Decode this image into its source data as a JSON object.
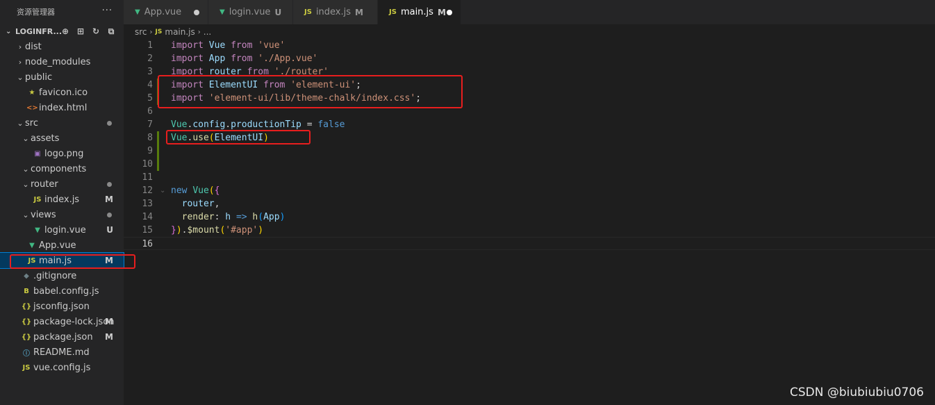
{
  "sidebar": {
    "title": "资源管理器",
    "more": "···",
    "project": "LOGINFR...",
    "items": [
      {
        "label": "dist",
        "icon": "",
        "depth": 0,
        "folder": true,
        "chev": "›",
        "badge": "",
        "dot": false,
        "iconName": "chevron-right-icon"
      },
      {
        "label": "node_modules",
        "icon": "",
        "depth": 0,
        "folder": true,
        "chev": "›",
        "badge": "",
        "dot": false,
        "iconName": "chevron-right-icon"
      },
      {
        "label": "public",
        "icon": "",
        "depth": 0,
        "folder": true,
        "chev": "⌄",
        "badge": "",
        "dot": false,
        "iconName": "chevron-down-icon"
      },
      {
        "label": "favicon.ico",
        "icon": "★",
        "cls": "c-star",
        "depth": 1,
        "folder": false,
        "badge": "",
        "dot": false,
        "iconName": "star-icon"
      },
      {
        "label": "index.html",
        "icon": "<>",
        "cls": "c-html",
        "depth": 1,
        "folder": false,
        "badge": "",
        "dot": false,
        "iconName": "html-icon"
      },
      {
        "label": "src",
        "icon": "",
        "depth": 0,
        "folder": true,
        "chev": "⌄",
        "badge": "",
        "dot": true,
        "iconName": "chevron-down-icon"
      },
      {
        "label": "assets",
        "icon": "",
        "depth": 1,
        "folder": true,
        "chev": "⌄",
        "badge": "",
        "dot": false,
        "iconName": "chevron-down-icon"
      },
      {
        "label": "logo.png",
        "icon": "▣",
        "cls": "c-img",
        "depth": 2,
        "folder": false,
        "badge": "",
        "dot": false,
        "iconName": "image-icon"
      },
      {
        "label": "components",
        "icon": "",
        "depth": 1,
        "folder": true,
        "chev": "⌄",
        "badge": "",
        "dot": false,
        "iconName": "chevron-down-icon"
      },
      {
        "label": "router",
        "icon": "",
        "depth": 1,
        "folder": true,
        "chev": "⌄",
        "badge": "",
        "dot": true,
        "iconName": "chevron-down-icon"
      },
      {
        "label": "index.js",
        "icon": "JS",
        "cls": "c-js",
        "depth": 2,
        "folder": false,
        "badge": "M",
        "dot": false,
        "iconName": "js-file-icon"
      },
      {
        "label": "views",
        "icon": "",
        "depth": 1,
        "folder": true,
        "chev": "⌄",
        "badge": "",
        "dot": true,
        "iconName": "chevron-down-icon"
      },
      {
        "label": "login.vue",
        "icon": "▼",
        "cls": "c-vue",
        "depth": 2,
        "folder": false,
        "badge": "U",
        "dot": false,
        "iconName": "vue-file-icon"
      },
      {
        "label": "App.vue",
        "icon": "▼",
        "cls": "c-vue",
        "depth": 1,
        "folder": false,
        "badge": "",
        "dot": false,
        "iconName": "vue-file-icon"
      },
      {
        "label": "main.js",
        "icon": "JS",
        "cls": "c-js",
        "depth": 1,
        "folder": false,
        "badge": "M",
        "dot": false,
        "selected": true,
        "iconName": "js-file-icon"
      },
      {
        "label": ".gitignore",
        "icon": "◆",
        "cls": "c-git",
        "depth": 0,
        "folder": false,
        "badge": "",
        "dot": false,
        "iconName": "git-icon"
      },
      {
        "label": "babel.config.js",
        "icon": "B",
        "cls": "c-js",
        "depth": 0,
        "folder": false,
        "badge": "",
        "dot": false,
        "iconName": "babel-icon"
      },
      {
        "label": "jsconfig.json",
        "icon": "{}",
        "cls": "c-json",
        "depth": 0,
        "folder": false,
        "badge": "",
        "dot": false,
        "iconName": "json-file-icon"
      },
      {
        "label": "package-lock.json",
        "icon": "{}",
        "cls": "c-json",
        "depth": 0,
        "folder": false,
        "badge": "M",
        "dot": false,
        "iconName": "json-file-icon"
      },
      {
        "label": "package.json",
        "icon": "{}",
        "cls": "c-json",
        "depth": 0,
        "folder": false,
        "badge": "M",
        "dot": false,
        "iconName": "json-file-icon"
      },
      {
        "label": "README.md",
        "icon": "ⓘ",
        "cls": "c-info",
        "depth": 0,
        "folder": false,
        "badge": "",
        "dot": false,
        "iconName": "info-icon"
      },
      {
        "label": "vue.config.js",
        "icon": "JS",
        "cls": "c-js",
        "depth": 0,
        "folder": false,
        "badge": "",
        "dot": false,
        "iconName": "js-file-icon"
      }
    ]
  },
  "tabs": [
    {
      "label": "App.vue",
      "icon": "▼",
      "cls": "c-vue",
      "badge": "",
      "dot": true,
      "active": false
    },
    {
      "label": "login.vue",
      "icon": "▼",
      "cls": "c-vue",
      "badge": "U",
      "dot": false,
      "active": false
    },
    {
      "label": "index.js",
      "icon": "JS",
      "cls": "c-js",
      "badge": "M",
      "dot": false,
      "active": false
    },
    {
      "label": "main.js",
      "icon": "JS",
      "cls": "c-js",
      "badge": "M",
      "dot": true,
      "active": true
    }
  ],
  "breadcrumb": {
    "folder": "src",
    "file_icon": "JS",
    "file": "main.js",
    "rest": "..."
  },
  "editor": {
    "lines": [
      {
        "n": "1",
        "html": "<span class='kw'>import</span> <span class='id'>Vue</span> <span class='kw'>from</span> <span class='st'>'vue'</span>"
      },
      {
        "n": "2",
        "html": "<span class='kw'>import</span> <span class='id'>App</span> <span class='kw'>from</span> <span class='st'>'./App.vue'</span>"
      },
      {
        "n": "3",
        "html": "<span class='kw'>import</span> <span class='id'>router</span> <span class='kw'>from</span> <span class='st'>'./router'</span>"
      },
      {
        "n": "4",
        "html": "<span class='kw'>import</span> <span class='id'>ElementUI</span> <span class='kw'>from</span> <span class='st'>'element-ui'</span><span class='pn'>;</span>"
      },
      {
        "n": "5",
        "html": "<span class='kw'>import</span> <span class='st'>'element-ui/lib/theme-chalk/index.css'</span><span class='pn'>;</span>"
      },
      {
        "n": "6",
        "html": ""
      },
      {
        "n": "7",
        "html": "<span class='cl'>Vue</span><span class='pn'>.</span><span class='id'>config</span><span class='pn'>.</span><span class='id'>productionTip</span> <span class='pn'>=</span> <span class='kb'>false</span>"
      },
      {
        "n": "8",
        "html": "<span class='cl'>Vue</span><span class='pn'>.</span><span class='fn'>use</span><span class='br1'>(</span><span class='id'>ElementUI</span><span class='br1'>)</span>"
      },
      {
        "n": "9",
        "html": ""
      },
      {
        "n": "10",
        "html": ""
      },
      {
        "n": "11",
        "html": ""
      },
      {
        "n": "12",
        "html": "<span class='kb'>new</span> <span class='cl'>Vue</span><span class='br1'>(</span><span class='br2'>{</span>"
      },
      {
        "n": "13",
        "html": "  <span class='id'>router</span><span class='pn'>,</span>"
      },
      {
        "n": "14",
        "html": "  <span class='fn'>render</span><span class='pn'>:</span> <span class='id'>h</span> <span class='kb'>=&gt;</span> <span class='fn'>h</span><span class='br3'>(</span><span class='id'>App</span><span class='br3'>)</span>"
      },
      {
        "n": "15",
        "html": "<span class='br2'>}</span><span class='br1'>)</span><span class='pn'>.</span><span class='fn'>$mount</span><span class='br1'>(</span><span class='st'>'#app'</span><span class='br1'>)</span>"
      },
      {
        "n": "16",
        "html": ""
      }
    ]
  },
  "watermark": "CSDN @biubiubiu0706"
}
